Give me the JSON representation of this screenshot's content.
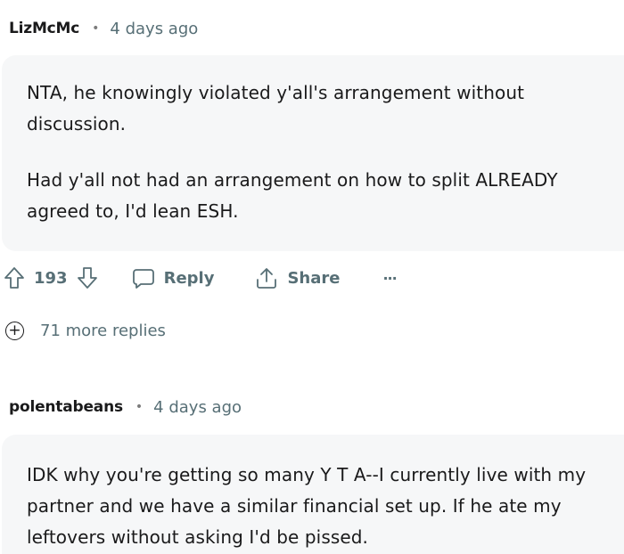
{
  "comments": [
    {
      "author": "LizMcMc",
      "separator": "•",
      "time": "4 days ago",
      "paragraphs": [
        "NTA, he knowingly violated y'all's arrangement without discussion.",
        "Had y'all not had an arrangement on how to split ALREADY agreed to, I'd lean ESH."
      ],
      "upvotes": "193",
      "reply_label": "Reply",
      "share_label": "Share",
      "more_label": "···",
      "more_replies": "71 more replies"
    },
    {
      "author": "polentabeans",
      "separator": "•",
      "time": "4 days ago",
      "paragraphs": [
        "IDK why you're getting so many Y T A--I currently live with my partner and we have a similar financial set up. If he ate my leftovers without asking I'd be pissed."
      ]
    }
  ],
  "icons": {
    "upvote": "arrow-up-outline",
    "downvote": "arrow-down-outline",
    "reply": "speech-bubble",
    "share": "share-arrow",
    "more_replies": "plus-circle"
  },
  "colors": {
    "text": "#1a1a1b",
    "meta": "#576f76",
    "bubble_bg": "#f6f7f8"
  }
}
